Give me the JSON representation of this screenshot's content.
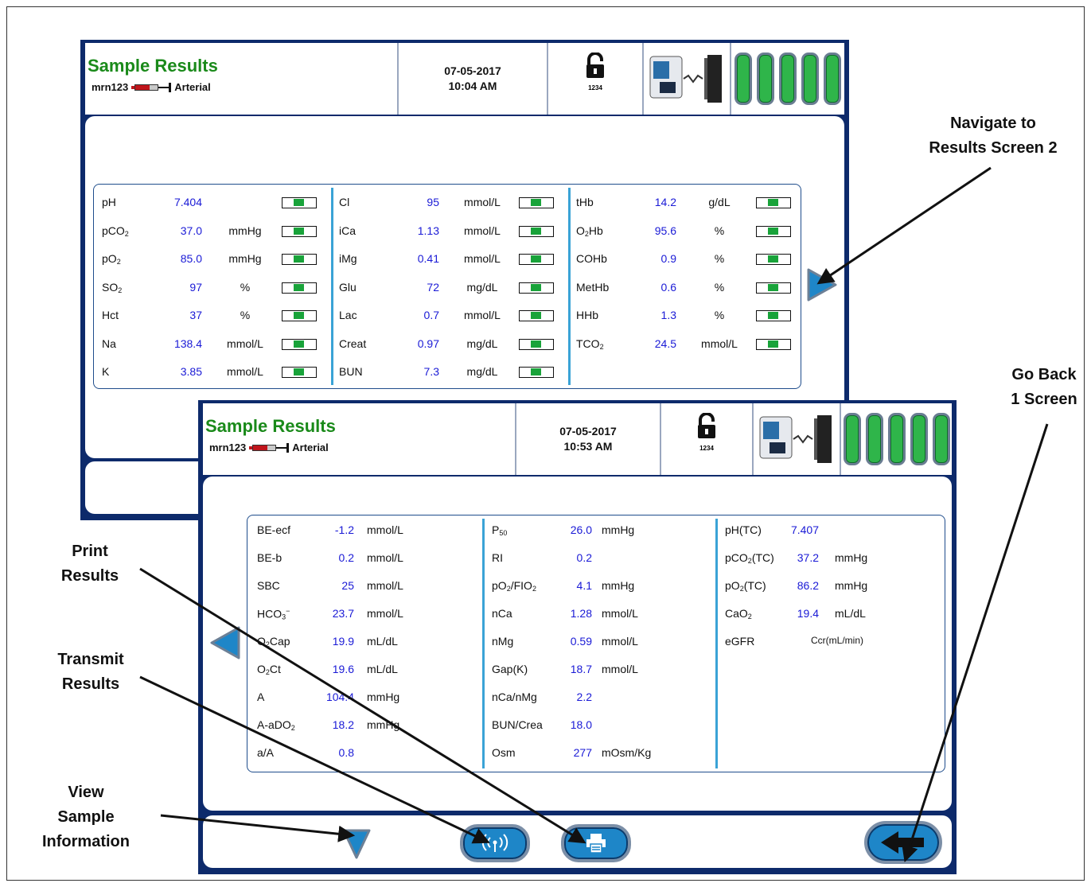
{
  "screen1": {
    "title": "Sample Results",
    "patient_id": "mrn123",
    "sample_type": "Arterial",
    "date": "07-05-2017",
    "time": "10:04 AM",
    "lock_code": "1234",
    "rows": [
      {
        "n": "pH",
        "v": "7.404",
        "u": "",
        "n2": "Cl",
        "v2": "95",
        "u2": "mmol/L",
        "n3": "tHb",
        "v3": "14.2",
        "u3": "g/dL"
      },
      {
        "n": "pCO",
        "s": "2",
        "v": "37.0",
        "u": "mmHg",
        "n2": "iCa",
        "v2": "1.13",
        "u2": "mmol/L",
        "n3": "O",
        "s3": "2",
        "n3b": "Hb",
        "v3": "95.6",
        "u3": "%"
      },
      {
        "n": "pO",
        "s": "2",
        "v": "85.0",
        "u": "mmHg",
        "n2": "iMg",
        "v2": "0.41",
        "u2": "mmol/L",
        "n3": "COHb",
        "v3": "0.9",
        "u3": "%"
      },
      {
        "n": "SO",
        "s": "2",
        "v": "97",
        "u": "%",
        "n2": "Glu",
        "v2": "72",
        "u2": "mg/dL",
        "n3": "MetHb",
        "v3": "0.6",
        "u3": "%"
      },
      {
        "n": "Hct",
        "v": "37",
        "u": "%",
        "n2": "Lac",
        "v2": "0.7",
        "u2": "mmol/L",
        "n3": "HHb",
        "v3": "1.3",
        "u3": "%"
      },
      {
        "n": "Na",
        "v": "138.4",
        "u": "mmol/L",
        "n2": "Creat",
        "v2": "0.97",
        "u2": "mg/dL",
        "n3": "TCO",
        "s3": "2",
        "v3": "24.5",
        "u3": "mmol/L"
      },
      {
        "n": "K",
        "v": "3.85",
        "u": "mmol/L",
        "n2": "BUN",
        "v2": "7.3",
        "u2": "mg/dL"
      }
    ]
  },
  "screen2": {
    "title": "Sample Results",
    "patient_id": "mrn123",
    "sample_type": "Arterial",
    "date": "07-05-2017",
    "time": "10:53 AM",
    "lock_code": "1234",
    "col1": [
      {
        "n": "BE-ecf",
        "v": "-1.2",
        "u": "mmol/L"
      },
      {
        "n": "BE-b",
        "v": "0.2",
        "u": "mmol/L"
      },
      {
        "n": "SBC",
        "v": "25",
        "u": "mmol/L"
      },
      {
        "n": "HCO",
        "sub": "3",
        "sup": "−",
        "v": "23.7",
        "u": "mmol/L"
      },
      {
        "n": "O",
        "sub": "2",
        "n_b": "Cap",
        "v": "19.9",
        "u": "mL/dL"
      },
      {
        "n": "O",
        "sub": "2",
        "n_b": "Ct",
        "v": "19.6",
        "u": "mL/dL"
      },
      {
        "n": "A",
        "v": "104.4",
        "u": "mmHg"
      },
      {
        "n": "A-aDO",
        "sub": "2",
        "v": "18.2",
        "u": "mmHg"
      },
      {
        "n": "a/A",
        "v": "0.8",
        "u": ""
      }
    ],
    "col2": [
      {
        "n": "P",
        "sub": "50",
        "v": "26.0",
        "u": "mmHg"
      },
      {
        "n": "RI",
        "v": "0.2",
        "u": ""
      },
      {
        "n": "pO",
        "sub": "2",
        "n_b": "/FIO",
        "sub_b": "2",
        "v": "4.1",
        "u": "mmHg"
      },
      {
        "n": "nCa",
        "v": "1.28",
        "u": "mmol/L"
      },
      {
        "n": "nMg",
        "v": "0.59",
        "u": "mmol/L"
      },
      {
        "n": "Gap(K)",
        "v": "18.7",
        "u": "mmol/L"
      },
      {
        "n": "nCa/nMg",
        "v": "2.2",
        "u": ""
      },
      {
        "n": "BUN/Crea",
        "v": "18.0",
        "u": ""
      },
      {
        "n": "Osm",
        "v": "277",
        "u": "mOsm/Kg"
      }
    ],
    "col3": [
      {
        "n": "pH(TC)",
        "v": "7.407",
        "u": ""
      },
      {
        "n": "pCO",
        "sub": "2",
        "n_b": "(TC)",
        "v": "37.2",
        "u": "mmHg"
      },
      {
        "n": "pO",
        "sub": "2",
        "n_b": "(TC)",
        "v": "86.2",
        "u": "mmHg"
      },
      {
        "n": "CaO",
        "sub": "2",
        "v": "19.4",
        "u": "mL/dL"
      },
      {
        "n": "eGFR",
        "v": "",
        "u": "Ccr(mL/min)"
      }
    ]
  },
  "callouts": {
    "navigate": "Navigate to Results Screen 2",
    "navigate_l1": "Navigate to",
    "navigate_l2": "Results Screen 2",
    "go_back_l1": "Go Back",
    "go_back_l2": "1 Screen",
    "print_l1": "Print",
    "print_l2": "Results",
    "transmit_l1": "Transmit",
    "transmit_l2": "Results",
    "view_l1": "View",
    "view_l2": "Sample",
    "view_l3": "Information"
  },
  "colors": {
    "title_green": "#1a8a1a",
    "value_blue": "#1a1ad6",
    "frame_navy": "#0d2a6b",
    "divider_cyan": "#3aa3d6",
    "button_blue": "#1e86c8",
    "battery_green": "#2fb54a"
  },
  "icons": [
    "lock-icon",
    "analyzer-device-icon",
    "battery-icon",
    "syringe-icon",
    "right-arrow-icon",
    "left-arrow-icon",
    "down-arrow-icon",
    "wireless-icon",
    "printer-icon",
    "back-arrow-icon"
  ]
}
